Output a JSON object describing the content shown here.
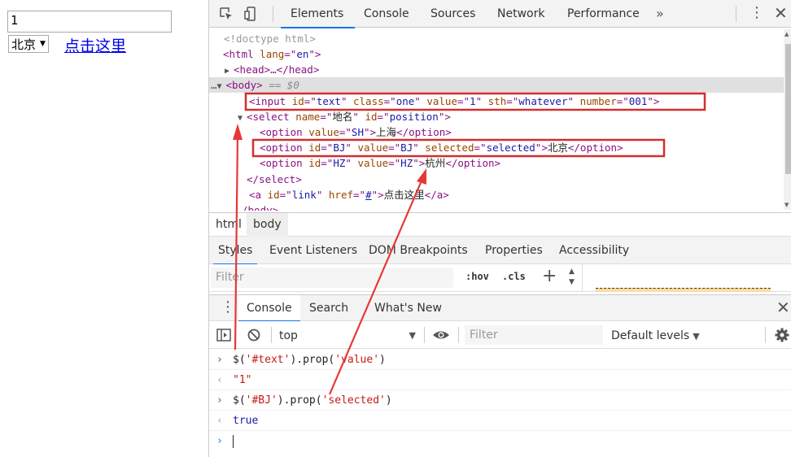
{
  "page": {
    "text_input_value": "1",
    "select_value": "北京",
    "link_text": "点击这里"
  },
  "devtools": {
    "tabs": [
      {
        "label": "Elements",
        "active": true
      },
      {
        "label": "Console",
        "active": false
      },
      {
        "label": "Sources",
        "active": false
      },
      {
        "label": "Network",
        "active": false
      },
      {
        "label": "Performance",
        "active": false
      }
    ],
    "more_tabs": "»",
    "elements_tree": {
      "doctype": "<!doctype html>",
      "html_open": "html",
      "html_lang_attr": "lang",
      "html_lang_val": "en",
      "head": "<head>…</head>",
      "body_tag": "<body>",
      "body_suffix": "== $0",
      "ellipsis": "…",
      "input": {
        "tag": "input",
        "attrs": [
          {
            "name": "id",
            "value": "text"
          },
          {
            "name": "class",
            "value": "one"
          },
          {
            "name": "value",
            "value": "1"
          },
          {
            "name": "sth",
            "value": "whatever"
          },
          {
            "name": "number",
            "value": "001"
          }
        ]
      },
      "select": {
        "tag": "select",
        "name_attr": "name",
        "name_val": "地名",
        "id_attr": "id",
        "id_val": "position",
        "close": "</select>"
      },
      "options": [
        {
          "prefix_attr": "value",
          "prefix_val": "SH",
          "text": "上海"
        },
        {
          "id": "BJ",
          "value": "BJ",
          "selected": "selected",
          "text": "北京"
        },
        {
          "id": "HZ",
          "value": "HZ",
          "text": "杭州"
        }
      ],
      "link": {
        "id": "link",
        "href": "#",
        "text": "点击这里"
      },
      "body_close": "/body>"
    },
    "breadcrumb": [
      "html",
      "body"
    ],
    "side_tabs": [
      "Styles",
      "Event Listeners",
      "DOM Breakpoints",
      "Properties",
      "Accessibility"
    ],
    "styles_filter_placeholder": "Filter",
    "hov": ":hov",
    "cls": ".cls",
    "drawer_tabs": [
      "Console",
      "Search",
      "What's New"
    ],
    "console_toolbar": {
      "context": "top",
      "filter_placeholder": "Filter",
      "levels": "Default levels"
    },
    "console_lines": [
      {
        "kind": "input",
        "selector": "'#text'",
        "method": "prop",
        "arg": "'value'"
      },
      {
        "kind": "result",
        "text": "\"1\""
      },
      {
        "kind": "input",
        "selector": "'#BJ'",
        "method": "prop",
        "arg": "'selected'"
      },
      {
        "kind": "result",
        "text": "true"
      }
    ]
  },
  "colors": {
    "highlight_box": "#d32f2f",
    "arrow": "#e53935",
    "accent": "#1a73e8"
  }
}
